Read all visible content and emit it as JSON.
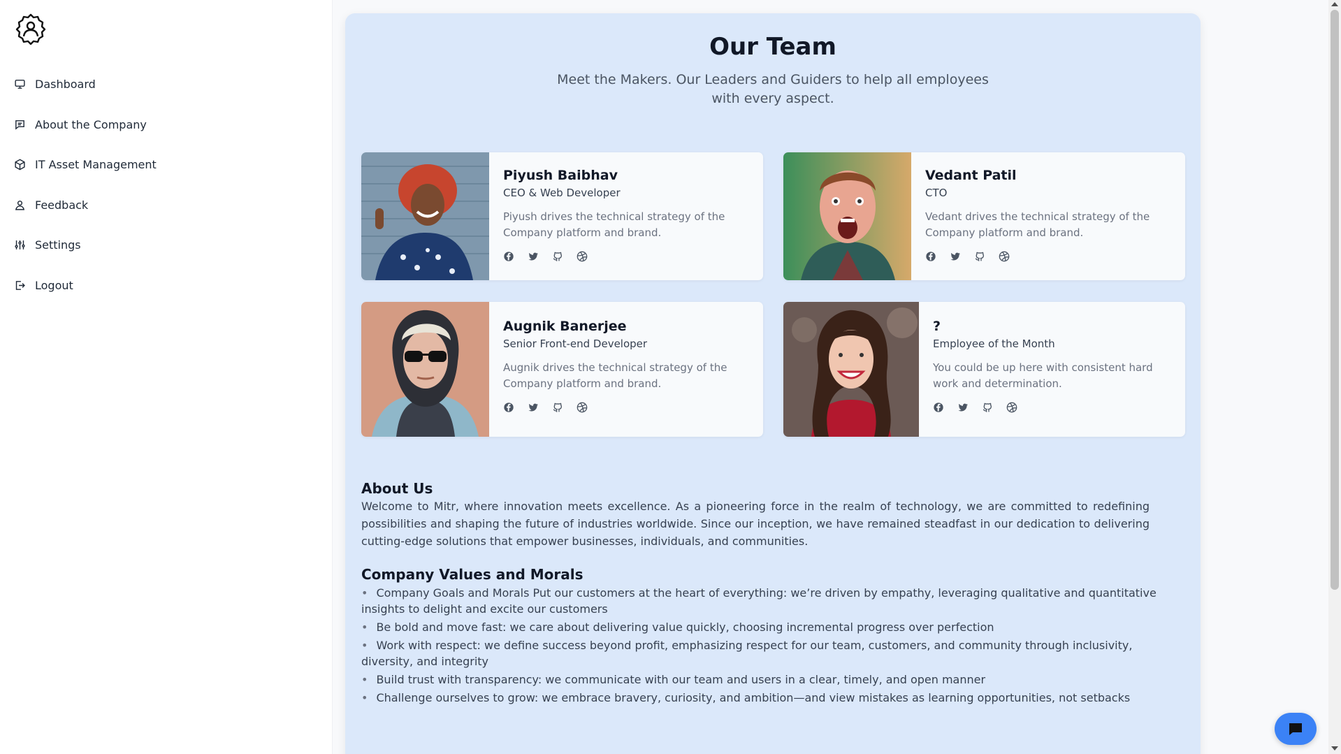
{
  "sidebar": {
    "items": [
      {
        "label": "Dashboard",
        "icon": "monitor-icon"
      },
      {
        "label": "About the Company",
        "icon": "message-icon"
      },
      {
        "label": "IT Asset Management",
        "icon": "box-icon"
      },
      {
        "label": "Feedback",
        "icon": "user-icon"
      },
      {
        "label": "Settings",
        "icon": "sliders-icon"
      },
      {
        "label": "Logout",
        "icon": "logout-icon"
      }
    ]
  },
  "team": {
    "title": "Our Team",
    "subtitle": "Meet the Makers. Our Leaders and Guiders to help all employees with every aspect.",
    "members": [
      {
        "name": "Piyush Baibhav",
        "role": "CEO & Web Developer",
        "description": "Piyush drives the technical strategy of the Company platform and brand."
      },
      {
        "name": "Vedant Patil",
        "role": "CTO",
        "description": "Vedant drives the technical strategy of the Company platform and brand."
      },
      {
        "name": "Augnik Banerjee",
        "role": "Senior Front-end Developer",
        "description": "Augnik drives the technical strategy of the Company platform and brand."
      },
      {
        "name": "?",
        "role": "Employee of the Month",
        "description": "You could be up here with consistent hard work and determination."
      }
    ]
  },
  "about": {
    "title": "About Us",
    "text": "Welcome to Mitr, where innovation meets excellence. As a pioneering force in the realm of technology, we are committed to redefining possibilities and shaping the future of industries worldwide. Since our inception, we have remained steadfast in our dedication to delivering cutting-edge solutions that empower businesses, individuals, and communities."
  },
  "values": {
    "title": "Company Values and Morals",
    "items": [
      "Company Goals and Morals Put our customers at the heart of everything: we’re driven by empathy, leveraging qualitative and quantitative insights to delight and excite our customers",
      "Be bold and move fast: we care about delivering value quickly, choosing incremental progress over perfection",
      "Work with respect: we define success beyond profit, emphasizing respect for our team, customers, and community through inclusivity, diversity, and integrity",
      "Build trust with transparency: we communicate with our team and users in a clear, timely, and open manner",
      "Challenge ourselves to grow: we embrace bravery, curiosity, and ambition—and view mistakes as learning opportunities, not setbacks"
    ]
  },
  "colors": {
    "panel": "#dbe8fa",
    "accent": "#3b82f6"
  }
}
